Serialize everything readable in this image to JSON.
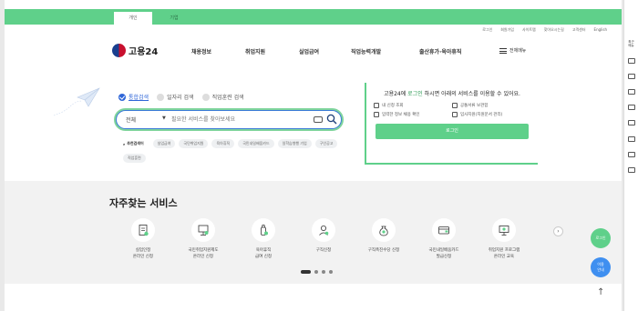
{
  "top_tabs": [
    "개인",
    "기업"
  ],
  "utility_links": [
    "로그인",
    "회원가입",
    "사이트맵",
    "찾아오시는길",
    "고객센터",
    "English"
  ],
  "logo": {
    "text": "고용24"
  },
  "gnb": {
    "items": [
      "채용정보",
      "취업지원",
      "실업급여",
      "직업능력개발",
      "출산휴가·육아휴직"
    ],
    "all_menu": "전체메뉴"
  },
  "search": {
    "options": [
      "통합검색",
      "일자리 검색",
      "직업훈련 검색"
    ],
    "selected_index": 0,
    "category": "전체",
    "placeholder": "필요한 서비스를 찾아보세요"
  },
  "recommend": {
    "label": "추천검색어",
    "chips": [
      "실업급여",
      "국민취업지원",
      "육아휴직",
      "국민내일배움카드",
      "일학습병행 기업",
      "구인공고",
      "직업훈련"
    ]
  },
  "login_panel": {
    "title_prefix": "고용24에 ",
    "title_highlight": "로그인",
    "title_suffix": " 하시면 아래의 서비스를 이용할 수 있어요.",
    "items": [
      "내 신청 조회",
      "공통서류 보관함",
      "입력한 정보 채용 확인",
      "입사지원(지원문서 관리)"
    ],
    "button": "로그인"
  },
  "services": {
    "title": "자주찾는 서비스",
    "items": [
      {
        "line1": "실업인정",
        "line2": "온라인 신청"
      },
      {
        "line1": "국민취업지원제도",
        "line2": "온라인 신청"
      },
      {
        "line1": "육아휴직",
        "line2": "급여 신청"
      },
      {
        "line1": "구직신청",
        "line2": ""
      },
      {
        "line1": "구직촉진수당 신청",
        "line2": ""
      },
      {
        "line1": "국민내일배움카드",
        "line2": "발급신청"
      },
      {
        "line1": "취업지원 프로그램",
        "line2": "온라인 교육"
      }
    ],
    "pages": 4,
    "active_page": 0
  },
  "floating": {
    "login": "로그인",
    "guide_line1": "이용",
    "guide_line2": "안내"
  },
  "rightbar": {
    "label_line1": "최근",
    "label_line2": "메뉴"
  },
  "colors": {
    "primary_green": "#5fd08a",
    "accent_blue": "#2f66d8",
    "highlight_green": "#2b9b54"
  }
}
